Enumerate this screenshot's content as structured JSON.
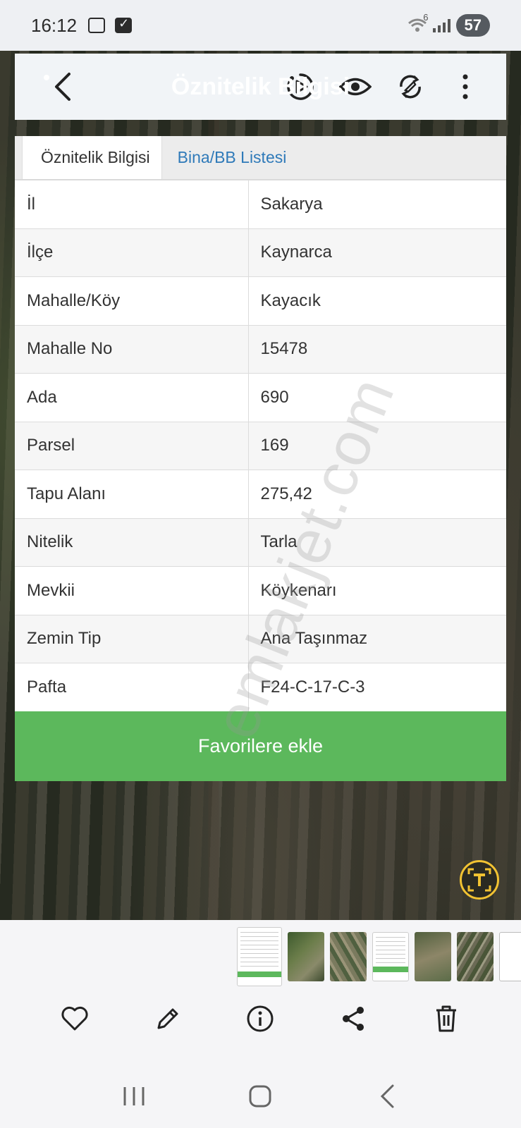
{
  "status_bar": {
    "time": "16:12",
    "wifi_label": "6",
    "battery": "57"
  },
  "header": {
    "title": "Öznitelik Bilgisi"
  },
  "tabs": [
    {
      "label": "Öznitelik Bilgisi",
      "active": true
    },
    {
      "label": "Bina/BB Listesi",
      "active": false
    }
  ],
  "attributes": [
    {
      "key": "İl",
      "value": "Sakarya"
    },
    {
      "key": "İlçe",
      "value": "Kaynarca"
    },
    {
      "key": "Mahalle/Köy",
      "value": "Kayacık"
    },
    {
      "key": "Mahalle No",
      "value": "15478"
    },
    {
      "key": "Ada",
      "value": "690"
    },
    {
      "key": "Parsel",
      "value": "169"
    },
    {
      "key": "Tapu Alanı",
      "value": "275,42"
    },
    {
      "key": "Nitelik",
      "value": "Tarla"
    },
    {
      "key": "Mevkii",
      "value": "Köykenarı"
    },
    {
      "key": "Zemin Tip",
      "value": "Ana Taşınmaz"
    },
    {
      "key": "Pafta",
      "value": "F24-C-17-C-3"
    }
  ],
  "favorite_button": "Favorilere ekle",
  "watermark": "emlakjet.com",
  "colors": {
    "accent_green": "#5cb85c",
    "tab_link_blue": "#2f7ab9",
    "ocr_ring_yellow": "#f1c232"
  },
  "icons": {
    "header": [
      "back-icon",
      "motion-photo-icon",
      "eye-icon",
      "rotate-icon",
      "more-vert-icon"
    ],
    "actions": [
      "heart-icon",
      "pencil-icon",
      "info-icon",
      "share-icon",
      "trash-icon"
    ],
    "nav": [
      "recents-icon",
      "home-icon",
      "back-nav-icon"
    ]
  }
}
